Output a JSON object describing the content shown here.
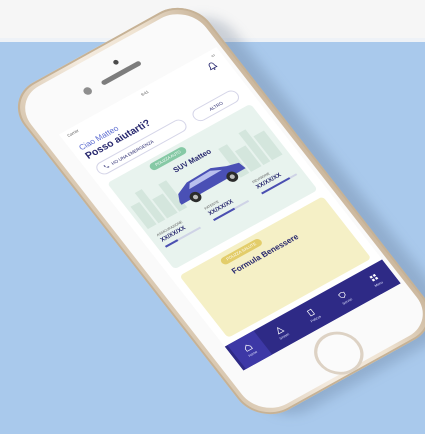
{
  "status_bar": {
    "carrier": "Carrier",
    "time": "9:41"
  },
  "header": {
    "greeting": "Ciao Matteo",
    "headline": "Posso aiutarti?"
  },
  "actions": {
    "emergency_label": "HO UNA EMERGENZA",
    "other_label": "ALTRO"
  },
  "vehicle_card": {
    "badge": "POLIZZA AUTO",
    "title": "SUV Matteo",
    "stats": [
      {
        "label": "ASSICURAZIONE",
        "value": "XX/XX/XX",
        "progress": 0.35
      },
      {
        "label": "PATENTE",
        "value": "XX/XX/XX",
        "progress": 0.6
      },
      {
        "label": "REVISIONE",
        "value": "XX/XX/XX",
        "progress": 0.8
      }
    ]
  },
  "wellness_card": {
    "badge": "POLIZZA SALUTE",
    "title": "Formula Benessere"
  },
  "tabbar": {
    "items": [
      {
        "label": "Home",
        "icon": "home-icon"
      },
      {
        "label": "Sinistri",
        "icon": "warning-icon"
      },
      {
        "label": "Polizze",
        "icon": "document-icon"
      },
      {
        "label": "Servizi",
        "icon": "shield-icon"
      },
      {
        "label": "Menu",
        "icon": "grid-icon"
      }
    ]
  },
  "colors": {
    "primary": "#2e2a86",
    "accent": "#5c6cd1",
    "background": "#a9c9ec",
    "car_card": "#e8f3ee",
    "wellness_card": "#f5f0c6"
  }
}
